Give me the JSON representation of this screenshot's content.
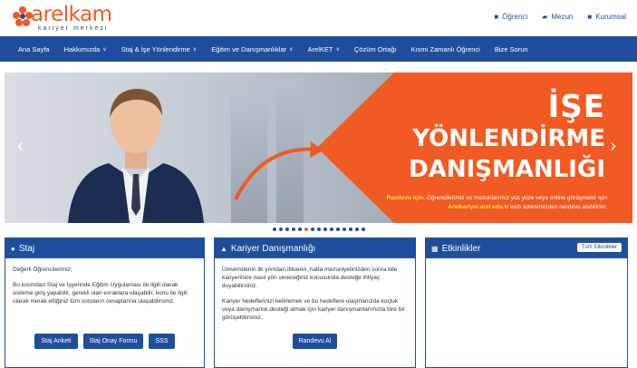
{
  "header": {
    "logo_text": "arelkam",
    "logo_sub": "kariyer merkezi",
    "user_links": [
      {
        "label": "Öğrenci",
        "icon": "book-icon"
      },
      {
        "label": "Mezun",
        "icon": "graduation-cap-icon"
      },
      {
        "label": "Kurumsal",
        "icon": "briefcase-icon"
      }
    ]
  },
  "nav": [
    {
      "label": "Ana Sayfa",
      "dropdown": false
    },
    {
      "label": "Hakkımızda",
      "dropdown": true
    },
    {
      "label": "Staj & İşe Yönlendirme",
      "dropdown": true
    },
    {
      "label": "Eğitim ve Danışmanlıklar",
      "dropdown": true
    },
    {
      "label": "ArelKET",
      "dropdown": true
    },
    {
      "label": "Çözüm Ortağı",
      "dropdown": false
    },
    {
      "label": "Kısmi Zamanlı Öğrenci",
      "dropdown": false
    },
    {
      "label": "Bize Sorun",
      "dropdown": false
    }
  ],
  "slider": {
    "line1": "İŞE",
    "line2": "YÖNLENDİRME",
    "line3": "DANIŞMANLIĞI",
    "small_prefix": "Randevu için:",
    "small_text": "Öğrencilerimiz ve mezunlarımız yüz yüze veya online görüşmeler için",
    "small_link": "Arelkariyer.arel.edu.tr",
    "small_suffix": "web adresimizden randevu alabilirler.",
    "colors": {
      "accent": "#f15a22",
      "primary": "#1f4e9d"
    },
    "dot_count": 15,
    "active_dot": 5
  },
  "panels": {
    "staj": {
      "title": "Staj",
      "icon": "info-circle-icon",
      "p1": "Değerli Öğrencilerimiz;",
      "p2": "Bu kısımdan Staj ve İşyerinde Eğitim Uygulaması ile ilgili olarak sisteme giriş yapabilir, gerekli olan evraklara ulaşabilir, konu ile ilgili olarak merak ettiğiniz tüm soruların cevaplarına ulaşabilirsiniz.",
      "buttons": [
        "Staj Anketi",
        "Staj Onay Formu",
        "SSS"
      ]
    },
    "kariyer": {
      "title": "Kariyer Danışmanlığı",
      "icon": "user-icon",
      "p1": "Üniversitenin ilk yılından itibaren, hatta mezuniyetinizden sonra bile kariyerinize nasıl yön vereceğiniz konusunda desteğe ihtiyaç duyabilirsiniz.",
      "p2": "Kariyer hedeflerinizi belirlemek ve bu hedeflere ulaşmanızda koçluk veya danışmanlık desteği almak için kariyer danışmanlarımızla bire bir görüşebilirsiniz.",
      "button": "Randevu Al"
    },
    "etkinlikler": {
      "title": "Etkinlikler",
      "icon": "calendar-icon",
      "all_button": "Tüm Etkinlikler"
    }
  }
}
